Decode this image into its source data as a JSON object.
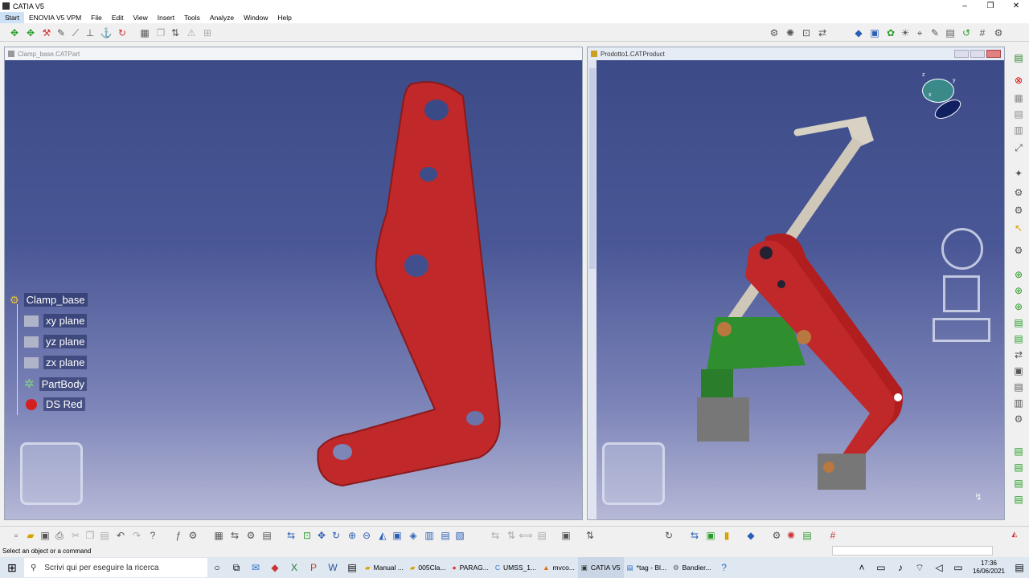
{
  "app": {
    "title": "CATIA V5",
    "window_controls": [
      "–",
      "❐",
      "✕"
    ]
  },
  "menu": [
    "Start",
    "ENOVIA V5 VPM",
    "File",
    "Edit",
    "View",
    "Insert",
    "Tools",
    "Analyze",
    "Window",
    "Help"
  ],
  "left_window": {
    "title": "Clamp_base.CATPart",
    "tree": {
      "root": "Clamp_base",
      "items": [
        "xy plane",
        "yz plane",
        "zx plane",
        "PartBody",
        "DS Red"
      ]
    }
  },
  "right_window": {
    "title": "Prodotto1.CATProduct",
    "axis_labels": {
      "x": "x",
      "y": "y",
      "z": "z"
    }
  },
  "status": {
    "message": "Select an object or a command"
  },
  "taskbar": {
    "search_placeholder": "Scrivi qui per eseguire la ricerca",
    "tasks": [
      "Manual ...",
      "005Cla...",
      "PARAG...",
      "UMSS_1...",
      "mvco...",
      "CATIA V5",
      "*tag - Bl...",
      "Bandier..."
    ],
    "time": "17:36",
    "date": "16/06/2021"
  },
  "colors": {
    "part_red": "#c0282a",
    "part_green": "#2f8f2f",
    "viewport_top": "#3c4b88",
    "viewport_bottom": "#b6b8d6"
  }
}
